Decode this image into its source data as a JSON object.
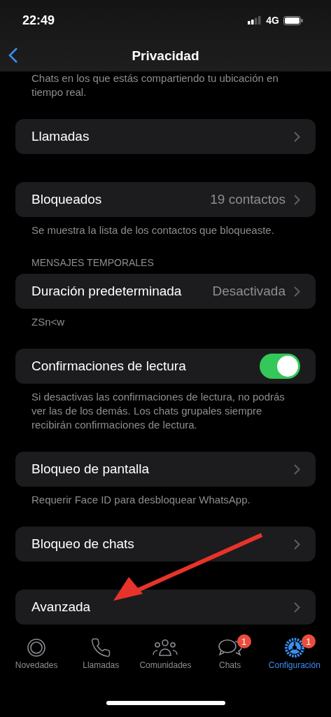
{
  "status_bar": {
    "time": "22:49",
    "network": "4G"
  },
  "nav": {
    "title": "Privacidad"
  },
  "sections": [
    {
      "footer": "Chats en los que estás compartiendo tu ubicación en tiempo real."
    },
    {
      "rows": [
        {
          "kind": "link",
          "label": "Llamadas"
        }
      ]
    },
    {
      "rows": [
        {
          "kind": "link",
          "label": "Bloqueados",
          "value": "19 contactos"
        }
      ],
      "footer": "Se muestra la lista de los contactos que bloqueaste."
    },
    {
      "header": "MENSAJES TEMPORALES",
      "rows": [
        {
          "kind": "link",
          "label": "Duración predeterminada",
          "value": "Desactivada"
        }
      ],
      "footer": "ZSn<w"
    },
    {
      "rows": [
        {
          "kind": "toggle",
          "label": "Confirmaciones de lectura",
          "on": true
        }
      ],
      "footer": "Si desactivas las confirmaciones de lectura, no podrás ver las de los demás. Los chats grupales siempre recibirán confirmaciones de lectura."
    },
    {
      "rows": [
        {
          "kind": "link",
          "label": "Bloqueo de pantalla"
        }
      ],
      "footer": "Requerir Face ID para desbloquear WhatsApp."
    },
    {
      "rows": [
        {
          "kind": "link",
          "label": "Bloqueo de chats"
        }
      ]
    },
    {
      "rows": [
        {
          "kind": "link",
          "label": "Avanzada"
        }
      ]
    }
  ],
  "annotation": {
    "kind": "arrow"
  },
  "tabs": [
    {
      "kind": "updates",
      "label": "Novedades",
      "selected": false
    },
    {
      "kind": "calls",
      "label": "Llamadas",
      "selected": false
    },
    {
      "kind": "communities",
      "label": "Comunidades",
      "selected": false
    },
    {
      "kind": "chats",
      "label": "Chats",
      "selected": false,
      "badge": "1"
    },
    {
      "kind": "settings",
      "label": "Configuración",
      "selected": true,
      "badge": "1"
    }
  ]
}
